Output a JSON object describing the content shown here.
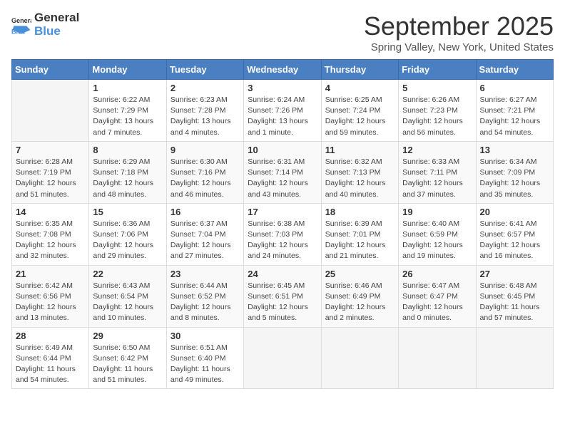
{
  "logo": {
    "text_general": "General",
    "text_blue": "Blue"
  },
  "title": "September 2025",
  "location": "Spring Valley, New York, United States",
  "days_of_week": [
    "Sunday",
    "Monday",
    "Tuesday",
    "Wednesday",
    "Thursday",
    "Friday",
    "Saturday"
  ],
  "weeks": [
    [
      {
        "day": "",
        "sunrise": "",
        "sunset": "",
        "daylight": ""
      },
      {
        "day": "1",
        "sunrise": "Sunrise: 6:22 AM",
        "sunset": "Sunset: 7:29 PM",
        "daylight": "Daylight: 13 hours and 7 minutes."
      },
      {
        "day": "2",
        "sunrise": "Sunrise: 6:23 AM",
        "sunset": "Sunset: 7:28 PM",
        "daylight": "Daylight: 13 hours and 4 minutes."
      },
      {
        "day": "3",
        "sunrise": "Sunrise: 6:24 AM",
        "sunset": "Sunset: 7:26 PM",
        "daylight": "Daylight: 13 hours and 1 minute."
      },
      {
        "day": "4",
        "sunrise": "Sunrise: 6:25 AM",
        "sunset": "Sunset: 7:24 PM",
        "daylight": "Daylight: 12 hours and 59 minutes."
      },
      {
        "day": "5",
        "sunrise": "Sunrise: 6:26 AM",
        "sunset": "Sunset: 7:23 PM",
        "daylight": "Daylight: 12 hours and 56 minutes."
      },
      {
        "day": "6",
        "sunrise": "Sunrise: 6:27 AM",
        "sunset": "Sunset: 7:21 PM",
        "daylight": "Daylight: 12 hours and 54 minutes."
      }
    ],
    [
      {
        "day": "7",
        "sunrise": "Sunrise: 6:28 AM",
        "sunset": "Sunset: 7:19 PM",
        "daylight": "Daylight: 12 hours and 51 minutes."
      },
      {
        "day": "8",
        "sunrise": "Sunrise: 6:29 AM",
        "sunset": "Sunset: 7:18 PM",
        "daylight": "Daylight: 12 hours and 48 minutes."
      },
      {
        "day": "9",
        "sunrise": "Sunrise: 6:30 AM",
        "sunset": "Sunset: 7:16 PM",
        "daylight": "Daylight: 12 hours and 46 minutes."
      },
      {
        "day": "10",
        "sunrise": "Sunrise: 6:31 AM",
        "sunset": "Sunset: 7:14 PM",
        "daylight": "Daylight: 12 hours and 43 minutes."
      },
      {
        "day": "11",
        "sunrise": "Sunrise: 6:32 AM",
        "sunset": "Sunset: 7:13 PM",
        "daylight": "Daylight: 12 hours and 40 minutes."
      },
      {
        "day": "12",
        "sunrise": "Sunrise: 6:33 AM",
        "sunset": "Sunset: 7:11 PM",
        "daylight": "Daylight: 12 hours and 37 minutes."
      },
      {
        "day": "13",
        "sunrise": "Sunrise: 6:34 AM",
        "sunset": "Sunset: 7:09 PM",
        "daylight": "Daylight: 12 hours and 35 minutes."
      }
    ],
    [
      {
        "day": "14",
        "sunrise": "Sunrise: 6:35 AM",
        "sunset": "Sunset: 7:08 PM",
        "daylight": "Daylight: 12 hours and 32 minutes."
      },
      {
        "day": "15",
        "sunrise": "Sunrise: 6:36 AM",
        "sunset": "Sunset: 7:06 PM",
        "daylight": "Daylight: 12 hours and 29 minutes."
      },
      {
        "day": "16",
        "sunrise": "Sunrise: 6:37 AM",
        "sunset": "Sunset: 7:04 PM",
        "daylight": "Daylight: 12 hours and 27 minutes."
      },
      {
        "day": "17",
        "sunrise": "Sunrise: 6:38 AM",
        "sunset": "Sunset: 7:03 PM",
        "daylight": "Daylight: 12 hours and 24 minutes."
      },
      {
        "day": "18",
        "sunrise": "Sunrise: 6:39 AM",
        "sunset": "Sunset: 7:01 PM",
        "daylight": "Daylight: 12 hours and 21 minutes."
      },
      {
        "day": "19",
        "sunrise": "Sunrise: 6:40 AM",
        "sunset": "Sunset: 6:59 PM",
        "daylight": "Daylight: 12 hours and 19 minutes."
      },
      {
        "day": "20",
        "sunrise": "Sunrise: 6:41 AM",
        "sunset": "Sunset: 6:57 PM",
        "daylight": "Daylight: 12 hours and 16 minutes."
      }
    ],
    [
      {
        "day": "21",
        "sunrise": "Sunrise: 6:42 AM",
        "sunset": "Sunset: 6:56 PM",
        "daylight": "Daylight: 12 hours and 13 minutes."
      },
      {
        "day": "22",
        "sunrise": "Sunrise: 6:43 AM",
        "sunset": "Sunset: 6:54 PM",
        "daylight": "Daylight: 12 hours and 10 minutes."
      },
      {
        "day": "23",
        "sunrise": "Sunrise: 6:44 AM",
        "sunset": "Sunset: 6:52 PM",
        "daylight": "Daylight: 12 hours and 8 minutes."
      },
      {
        "day": "24",
        "sunrise": "Sunrise: 6:45 AM",
        "sunset": "Sunset: 6:51 PM",
        "daylight": "Daylight: 12 hours and 5 minutes."
      },
      {
        "day": "25",
        "sunrise": "Sunrise: 6:46 AM",
        "sunset": "Sunset: 6:49 PM",
        "daylight": "Daylight: 12 hours and 2 minutes."
      },
      {
        "day": "26",
        "sunrise": "Sunrise: 6:47 AM",
        "sunset": "Sunset: 6:47 PM",
        "daylight": "Daylight: 12 hours and 0 minutes."
      },
      {
        "day": "27",
        "sunrise": "Sunrise: 6:48 AM",
        "sunset": "Sunset: 6:45 PM",
        "daylight": "Daylight: 11 hours and 57 minutes."
      }
    ],
    [
      {
        "day": "28",
        "sunrise": "Sunrise: 6:49 AM",
        "sunset": "Sunset: 6:44 PM",
        "daylight": "Daylight: 11 hours and 54 minutes."
      },
      {
        "day": "29",
        "sunrise": "Sunrise: 6:50 AM",
        "sunset": "Sunset: 6:42 PM",
        "daylight": "Daylight: 11 hours and 51 minutes."
      },
      {
        "day": "30",
        "sunrise": "Sunrise: 6:51 AM",
        "sunset": "Sunset: 6:40 PM",
        "daylight": "Daylight: 11 hours and 49 minutes."
      },
      {
        "day": "",
        "sunrise": "",
        "sunset": "",
        "daylight": ""
      },
      {
        "day": "",
        "sunrise": "",
        "sunset": "",
        "daylight": ""
      },
      {
        "day": "",
        "sunrise": "",
        "sunset": "",
        "daylight": ""
      },
      {
        "day": "",
        "sunrise": "",
        "sunset": "",
        "daylight": ""
      }
    ]
  ]
}
